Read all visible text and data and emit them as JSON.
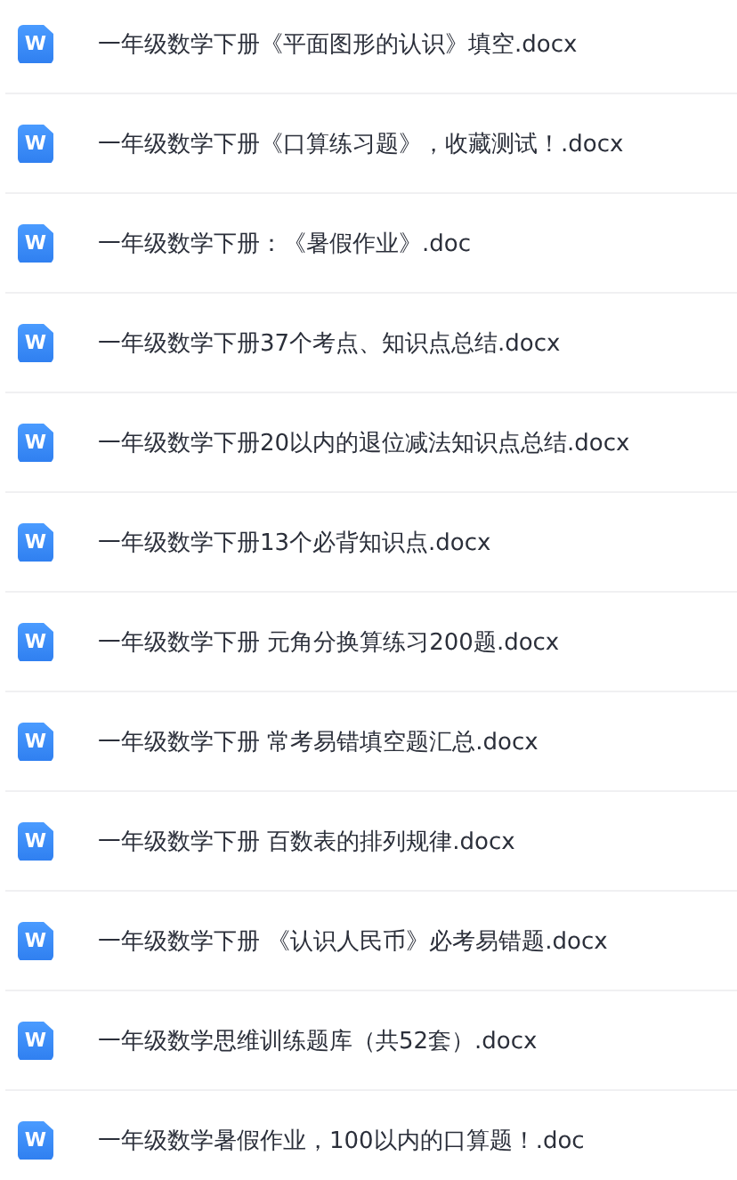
{
  "files": [
    {
      "icon_text": "W",
      "name": "一年级数学下册《平面图形的认识》填空.docx"
    },
    {
      "icon_text": "W",
      "name": "一年级数学下册《口算练习题》，收藏测试！.docx"
    },
    {
      "icon_text": "W",
      "name": "一年级数学下册：《暑假作业》.doc"
    },
    {
      "icon_text": "W",
      "name": "一年级数学下册37个考点、知识点总结.docx"
    },
    {
      "icon_text": "W",
      "name": "一年级数学下册20以内的退位减法知识点总结.docx"
    },
    {
      "icon_text": "W",
      "name": "一年级数学下册13个必背知识点.docx"
    },
    {
      "icon_text": "W",
      "name": "一年级数学下册 元角分换算练习200题.docx"
    },
    {
      "icon_text": "W",
      "name": "一年级数学下册 常考易错填空题汇总.docx"
    },
    {
      "icon_text": "W",
      "name": "一年级数学下册 百数表的排列规律.docx"
    },
    {
      "icon_text": "W",
      "name": "一年级数学下册 《认识人民币》必考易错题.docx"
    },
    {
      "icon_text": "W",
      "name": "一年级数学思维训练题库（共52套）.docx"
    },
    {
      "icon_text": "W",
      "name": "一年级数学暑假作业，100以内的口算题！.doc"
    }
  ]
}
